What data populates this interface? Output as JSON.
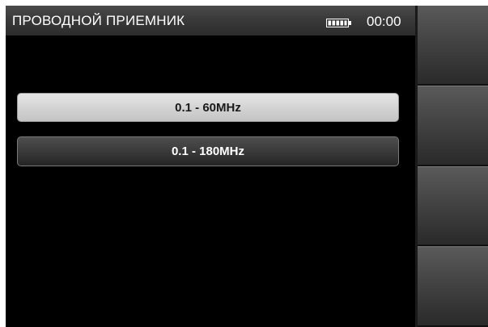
{
  "header": {
    "title": "ПРОВОДНОЙ ПРИЕМНИК",
    "time": "00:00",
    "battery_icon": "battery-full-icon"
  },
  "menu": {
    "options": [
      {
        "label": "0.1 - 60MHz",
        "selected": true
      },
      {
        "label": "0.1 - 180MHz",
        "selected": false
      }
    ]
  },
  "softkeys": {
    "count": 4,
    "labels": [
      "",
      "",
      "",
      ""
    ]
  },
  "colors": {
    "background": "#000000",
    "titlebar": "#3a3a3a",
    "selected_option": "#d2d2d2",
    "option": "#3a3a3a"
  }
}
